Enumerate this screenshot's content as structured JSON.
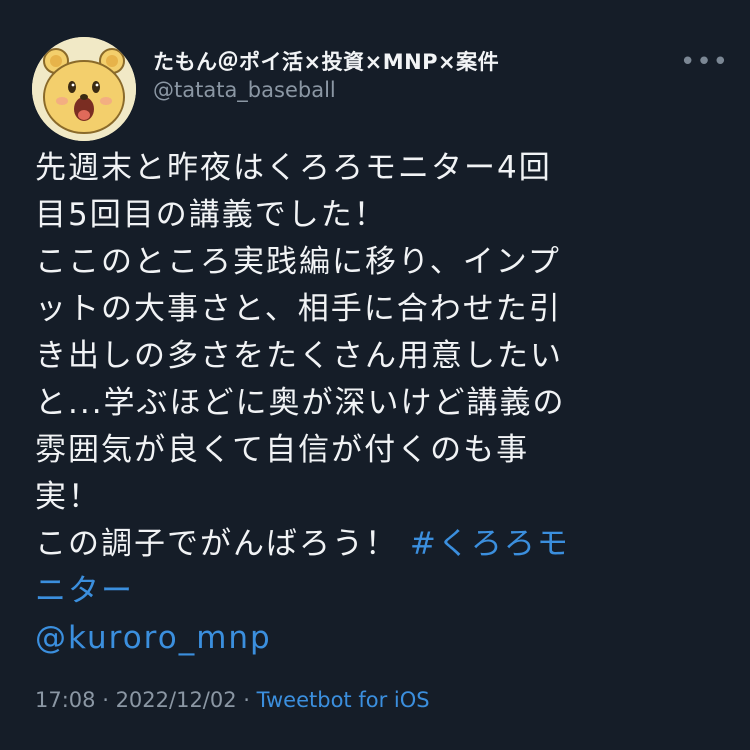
{
  "user": {
    "display_name": "たもん＠ポイ活×投資×MNP×案件",
    "handle": "@tatata_baseball",
    "avatar": "cartoon-bear-avatar-icon"
  },
  "more_icon": "more-horizontal-icon",
  "tweet": {
    "lines": [
      "先週末と昨夜はくろろモニター4回",
      "目5回目の講義でした！",
      "ここのところ実践編に移り、インプ",
      "ットの大事さと、相手に合わせた引",
      "き出しの多さをたくさん用意したい",
      "と...学ぶほどに奥が深いけど講義の",
      "雰囲気が良くて自信が付くのも事",
      "実！"
    ],
    "last_line_text": "この調子でがんばろう！ ",
    "hashtag_part1": "#くろろモ",
    "hashtag_part2": "ニター",
    "mention": "@kuroro_mnp"
  },
  "meta": {
    "time": "17:08",
    "separator1": " · ",
    "date": "2022/12/02",
    "separator2": " · ",
    "source": "Tweetbot for iOS"
  },
  "colors": {
    "background": "#151d28",
    "text": "#f1f3f5",
    "secondary": "#8b97a4",
    "link": "#3b8fde"
  }
}
